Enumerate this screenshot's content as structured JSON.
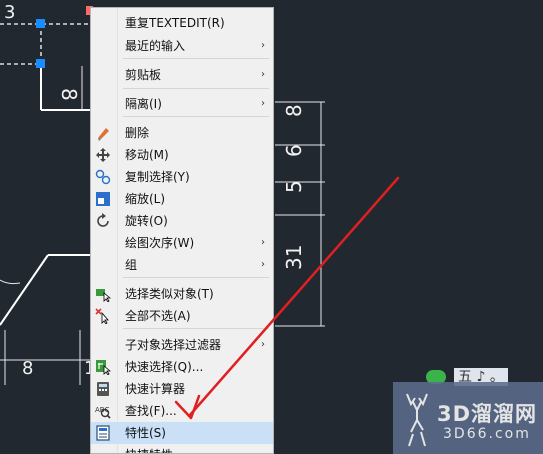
{
  "drawing": {
    "dims": [
      "3",
      "8",
      "8",
      "6",
      "5",
      "31",
      "8",
      "1"
    ],
    "grip_color": "#1a8cff",
    "line_color": "#ffffff",
    "background": "#212830"
  },
  "context_menu": {
    "items": [
      {
        "label": "重复TEXTEDIT(R)",
        "icon": "",
        "submenu": false
      },
      {
        "label": "最近的输入",
        "icon": "",
        "submenu": true
      },
      {
        "label": "剪贴板",
        "icon": "",
        "submenu": true
      },
      {
        "label": "隔离(I)",
        "icon": "",
        "submenu": true
      },
      {
        "label": "删除",
        "icon": "eraser-icon",
        "submenu": false
      },
      {
        "label": "移动(M)",
        "icon": "move-icon",
        "submenu": false
      },
      {
        "label": "复制选择(Y)",
        "icon": "copy-icon",
        "submenu": false
      },
      {
        "label": "缩放(L)",
        "icon": "scale-icon",
        "submenu": false
      },
      {
        "label": "旋转(O)",
        "icon": "rotate-icon",
        "submenu": false
      },
      {
        "label": "绘图次序(W)",
        "icon": "",
        "submenu": true
      },
      {
        "label": "组",
        "icon": "",
        "submenu": true
      },
      {
        "label": "选择类似对象(T)",
        "icon": "select-similar-icon",
        "submenu": false
      },
      {
        "label": "全部不选(A)",
        "icon": "deselect-all-icon",
        "submenu": false
      },
      {
        "label": "子对象选择过滤器",
        "icon": "",
        "submenu": true
      },
      {
        "label": "快速选择(Q)...",
        "icon": "quick-select-icon",
        "submenu": false
      },
      {
        "label": "快速计算器",
        "icon": "calculator-icon",
        "submenu": false
      },
      {
        "label": "查找(F)...",
        "icon": "find-icon",
        "submenu": false
      },
      {
        "label": "特性(S)",
        "icon": "properties-icon",
        "submenu": false
      },
      {
        "label": "快捷特性",
        "icon": "",
        "submenu": false
      }
    ],
    "submenu_arrow": "›"
  },
  "watermark": {
    "chip_text": "五 ♪ 。",
    "logo_name": "3D溜溜网",
    "logo_url": "3D66.com",
    "annotation_color": "#e02020"
  }
}
